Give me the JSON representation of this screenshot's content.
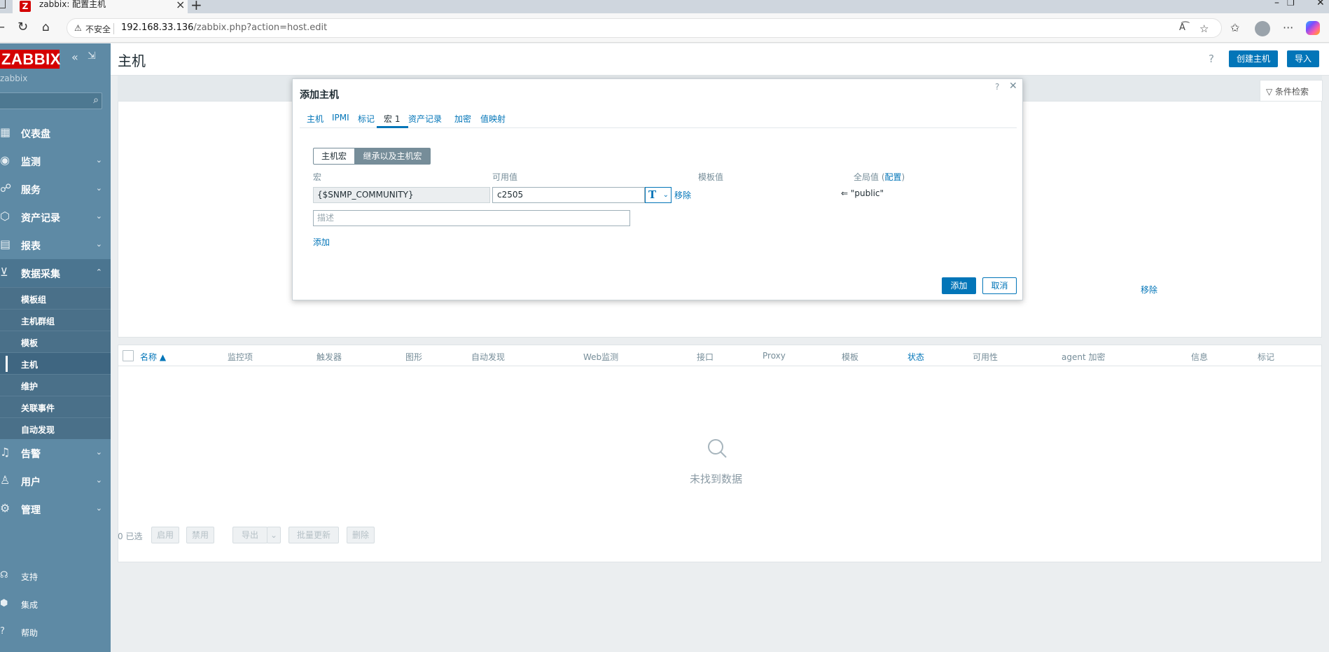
{
  "browser": {
    "tab_title": "zabbix: 配置主机",
    "tab_favicon": "Z",
    "not_secure": "不安全",
    "url_host": "192.168.33.136",
    "url_path": "/zabbix.php?action=host.edit"
  },
  "sidebar": {
    "logo": "ZABBIX",
    "server_name": "zabbix",
    "menu": [
      {
        "label": "仪表盘",
        "icon": "dashboard-icon"
      },
      {
        "label": "监测",
        "icon": "monitoring-icon"
      },
      {
        "label": "服务",
        "icon": "services-icon"
      },
      {
        "label": "资产记录",
        "icon": "inventory-icon"
      },
      {
        "label": "报表",
        "icon": "reports-icon"
      },
      {
        "label": "数据采集",
        "icon": "data-collection-icon"
      }
    ],
    "submenu": [
      "模板组",
      "主机群组",
      "模板",
      "主机",
      "维护",
      "关联事件",
      "自动发现"
    ],
    "menu2": [
      {
        "label": "告警",
        "icon": "alerts-icon"
      },
      {
        "label": "用户",
        "icon": "users-icon"
      },
      {
        "label": "管理",
        "icon": "administration-icon"
      }
    ],
    "footer": [
      "支持",
      "集成",
      "帮助"
    ]
  },
  "page": {
    "title": "主机",
    "create_button": "创建主机",
    "import_button": "导入",
    "filter_tab": "条件检索",
    "behind_remove": "移除"
  },
  "list": {
    "columns": [
      "名称 ▲",
      "监控项",
      "触发器",
      "图形",
      "自动发现",
      "Web监测",
      "接口",
      "Proxy",
      "模板",
      "状态",
      "可用性",
      "agent 加密",
      "信息",
      "标记"
    ],
    "no_data": "未找到数据",
    "selected": "0 已选",
    "actions": [
      "启用",
      "禁用",
      "导出",
      "批量更新",
      "删除"
    ]
  },
  "modal": {
    "title": "添加主机",
    "tabs": [
      "主机",
      "IPMI",
      "标记",
      "宏 1",
      "资产记录",
      "加密",
      "值映射"
    ],
    "active_tab": 3,
    "segment": [
      "主机宏",
      "继承以及主机宏"
    ],
    "columns": {
      "macro": "宏",
      "effective": "可用值",
      "template": "模板值",
      "global": "全局值",
      "config_link": "配置"
    },
    "macro_name": "{$SNMP_COMMUNITY}",
    "macro_value": "c2505",
    "type_glyph": "T",
    "remove_link": "移除",
    "global_value": "⇐ \"public\"",
    "description_placeholder": "描述",
    "add_link": "添加",
    "submit_button": "添加",
    "cancel_button": "取消"
  },
  "colors": {
    "sidebar": "#5e8aa5",
    "accent": "#0275b8",
    "logo": "#d40000"
  }
}
